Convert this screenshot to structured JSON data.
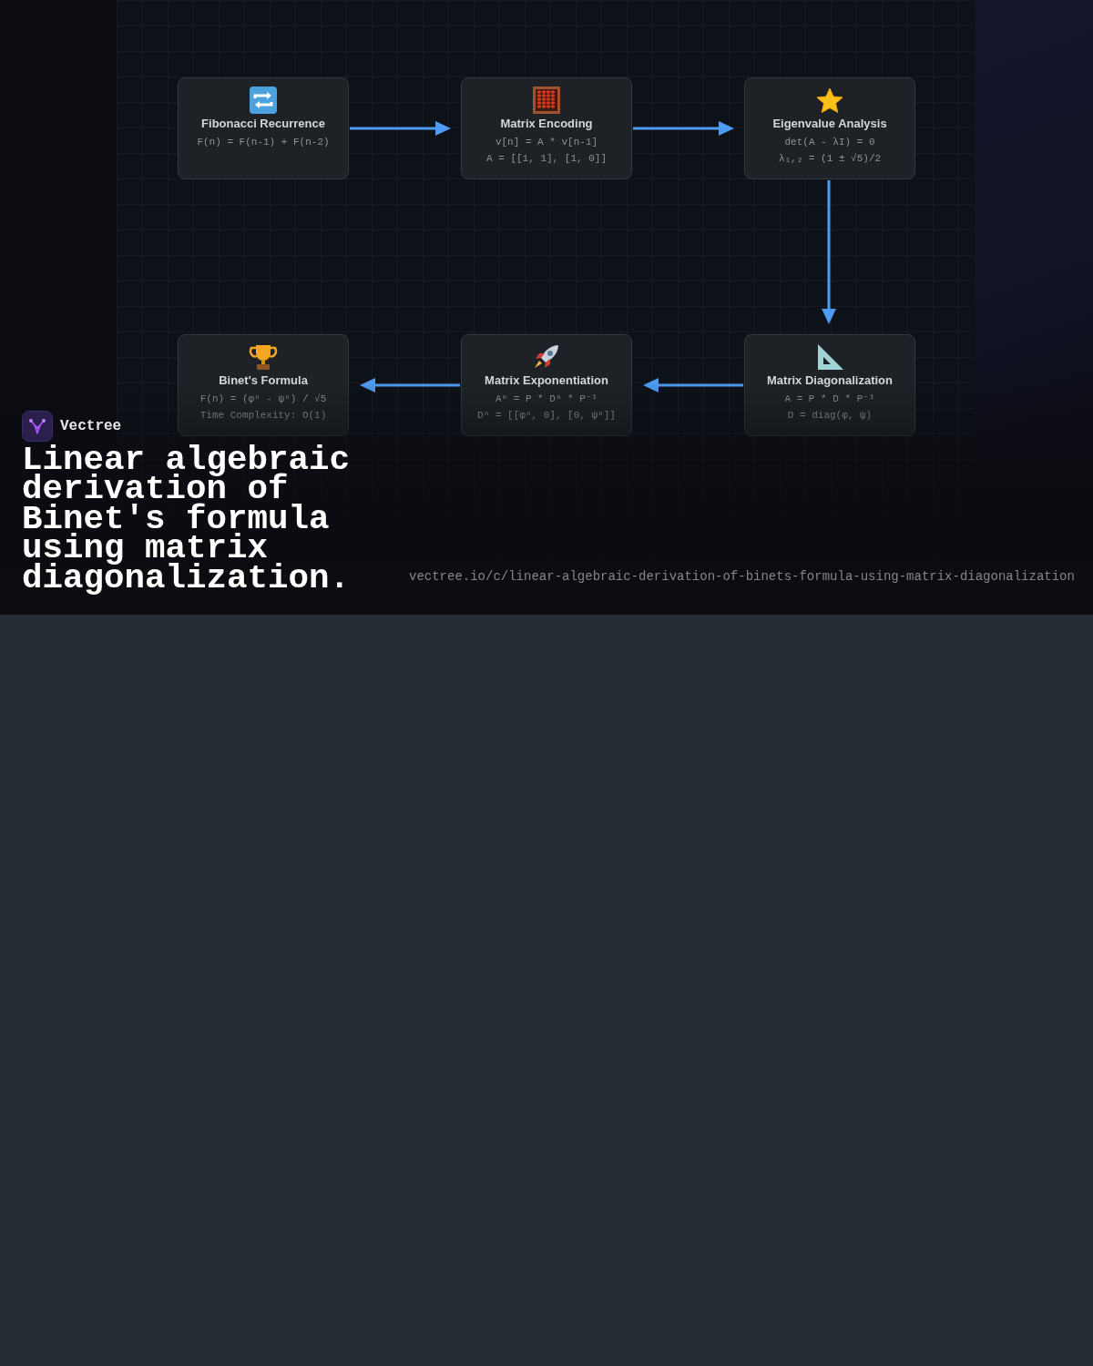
{
  "diagram": {
    "nodes": [
      {
        "title": "Fibonacci Recurrence",
        "lines": [
          "F(n) = F(n-1) + F(n-2)"
        ]
      },
      {
        "title": "Matrix Encoding",
        "lines": [
          "v[n] = A * v[n-1]",
          "A = [[1, 1], [1, 0]]"
        ]
      },
      {
        "title": "Eigenvalue Analysis",
        "lines": [
          "det(A - λI) = 0",
          "λ₁,₂ = (1 ± √5)/2"
        ]
      },
      {
        "title": "Binet's Formula",
        "lines": [
          "F(n) = (φⁿ - ψⁿ) / √5",
          "Time Complexity: O(1)"
        ]
      },
      {
        "title": "Matrix Exponentiation",
        "lines": [
          "Aⁿ = P * Dⁿ * P⁻¹",
          "Dⁿ = [[φⁿ, 0], [0, ψⁿ]]"
        ]
      },
      {
        "title": "Matrix Diagonalization",
        "lines": [
          "A = P * D * P⁻¹",
          "D = diag(φ, ψ)"
        ]
      }
    ]
  },
  "brand": "Vectree",
  "title": "Linear algebraic derivation of Binet's formula using matrix diagonalization.",
  "url": "vectree.io/c/linear-algebraic-derivation-of-binets-formula-using-matrix-diagonalization"
}
